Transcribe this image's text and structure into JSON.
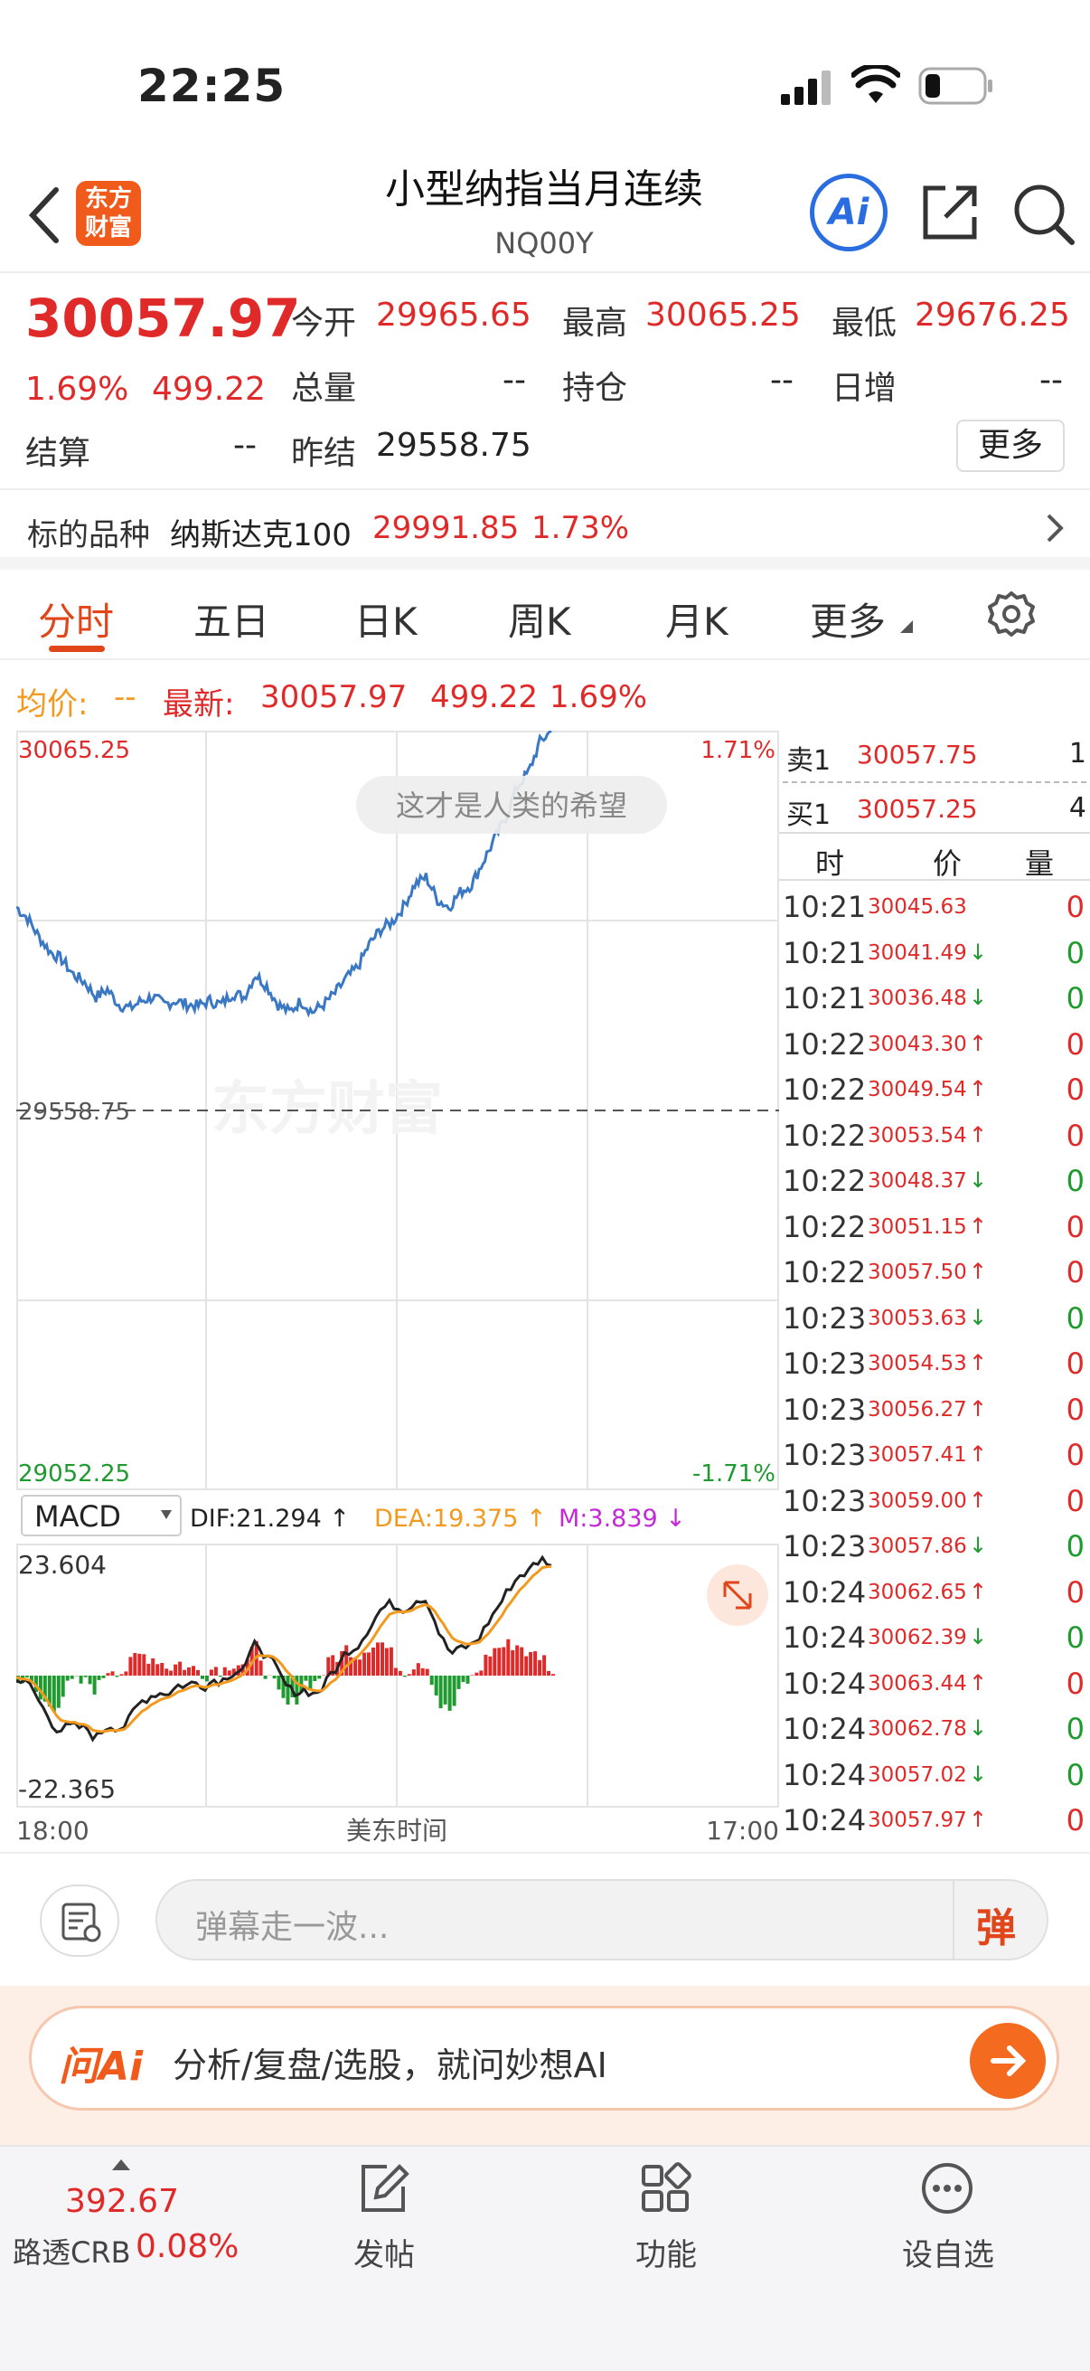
{
  "status_bar": {
    "time": "22:25"
  },
  "header": {
    "logo_text_line1": "东方",
    "logo_text_line2": "财富",
    "title": "小型纳指当月连续",
    "code": "NQ00Y",
    "ai_label": "Ai"
  },
  "quote": {
    "last_price": "30057.97",
    "change_pct": "1.69%",
    "change_amt": "499.22",
    "open_label": "今开",
    "open": "29965.65",
    "high_label": "最高",
    "high": "30065.25",
    "low_label": "最低",
    "low": "29676.25",
    "volume_label": "总量",
    "volume": "--",
    "oi_label": "持仓",
    "oi": "--",
    "daily_inc_label": "日增",
    "daily_inc": "--",
    "settle_label": "结算",
    "settle": "--",
    "prev_settle_label": "昨结",
    "prev_settle": "29558.75",
    "more_button": "更多"
  },
  "underlying": {
    "label": "标的品种",
    "name": "纳斯达克100",
    "price": "29991.85",
    "pct": "1.73%"
  },
  "tabs": [
    "分时",
    "五日",
    "日K",
    "周K",
    "月K",
    "更多"
  ],
  "price_bar": {
    "avg_label": "均价:",
    "avg_value": "--",
    "latest_label": "最新:",
    "latest_value": "30057.97",
    "change_amt": "499.22",
    "change_pct": "1.69%"
  },
  "chart": {
    "y_top": "30065.25",
    "y_mid": "29558.75",
    "y_bottom": "29052.25",
    "pct_top": "1.71%",
    "pct_bottom": "-1.71%",
    "bubble": "这才是人类的希望",
    "watermark": "东方财富",
    "macd_select": "MACD",
    "dif": "DIF:21.294 ↑",
    "dea": "DEA:19.375 ↑",
    "m": "M:3.839 ↓",
    "macd_top": "23.604",
    "macd_bottom": "-22.365",
    "x_start": "18:00",
    "x_mid": "美东时间",
    "x_end": "17:00",
    "colors": {
      "price_line": "#3a78c4",
      "dif": "#222222",
      "dea": "#f39a1e",
      "up": "#e02a2a",
      "down": "#1e9a2f"
    }
  },
  "chart_data": {
    "type": "line",
    "title": "",
    "xlabel": "美东时间",
    "ylabel": "",
    "ylim": [
      29052.25,
      30065.25
    ],
    "x_ticks": [
      "18:00",
      "17:00"
    ],
    "series": [
      {
        "values": [
          29830,
          29815,
          29790,
          29770,
          29760,
          29740,
          29730,
          29710,
          29720,
          29700,
          29695,
          29705,
          29710,
          29700,
          29705,
          29700,
          29698,
          29705,
          29700,
          29715,
          29710,
          29740,
          29725,
          29700,
          29690,
          29705,
          29690,
          29700,
          29715,
          29735,
          29750,
          29780,
          29800,
          29810,
          29830,
          29860,
          29870,
          29840,
          29830,
          29850,
          29860,
          29890,
          29920,
          29950,
          29990,
          30010,
          30050,
          30065
        ]
      }
    ]
  },
  "orderbook": {
    "sell_label": "卖1",
    "sell_price": "30057.75",
    "sell_qty": "1",
    "buy_label": "买1",
    "buy_price": "30057.25",
    "buy_qty": "4",
    "head_time": "时",
    "head_price": "价",
    "head_qty": "量",
    "ticks": [
      {
        "time": "10:21",
        "price": "30045.63",
        "arrow": "",
        "qty": "0",
        "dir": "up"
      },
      {
        "time": "10:21",
        "price": "30041.49",
        "arrow": "↓",
        "qty": "0",
        "dir": "down"
      },
      {
        "time": "10:21",
        "price": "30036.48",
        "arrow": "↓",
        "qty": "0",
        "dir": "down"
      },
      {
        "time": "10:22",
        "price": "30043.30",
        "arrow": "↑",
        "qty": "0",
        "dir": "up"
      },
      {
        "time": "10:22",
        "price": "30049.54",
        "arrow": "↑",
        "qty": "0",
        "dir": "up"
      },
      {
        "time": "10:22",
        "price": "30053.54",
        "arrow": "↑",
        "qty": "0",
        "dir": "up"
      },
      {
        "time": "10:22",
        "price": "30048.37",
        "arrow": "↓",
        "qty": "0",
        "dir": "down"
      },
      {
        "time": "10:22",
        "price": "30051.15",
        "arrow": "↑",
        "qty": "0",
        "dir": "up"
      },
      {
        "time": "10:22",
        "price": "30057.50",
        "arrow": "↑",
        "qty": "0",
        "dir": "up"
      },
      {
        "time": "10:23",
        "price": "30053.63",
        "arrow": "↓",
        "qty": "0",
        "dir": "down"
      },
      {
        "time": "10:23",
        "price": "30054.53",
        "arrow": "↑",
        "qty": "0",
        "dir": "up"
      },
      {
        "time": "10:23",
        "price": "30056.27",
        "arrow": "↑",
        "qty": "0",
        "dir": "up"
      },
      {
        "time": "10:23",
        "price": "30057.41",
        "arrow": "↑",
        "qty": "0",
        "dir": "up"
      },
      {
        "time": "10:23",
        "price": "30059.00",
        "arrow": "↑",
        "qty": "0",
        "dir": "up"
      },
      {
        "time": "10:23",
        "price": "30057.86",
        "arrow": "↓",
        "qty": "0",
        "dir": "down"
      },
      {
        "time": "10:24",
        "price": "30062.65",
        "arrow": "↑",
        "qty": "0",
        "dir": "up"
      },
      {
        "time": "10:24",
        "price": "30062.39",
        "arrow": "↓",
        "qty": "0",
        "dir": "down"
      },
      {
        "time": "10:24",
        "price": "30063.44",
        "arrow": "↑",
        "qty": "0",
        "dir": "up"
      },
      {
        "time": "10:24",
        "price": "30062.78",
        "arrow": "↓",
        "qty": "0",
        "dir": "down"
      },
      {
        "time": "10:24",
        "price": "30057.02",
        "arrow": "↓",
        "qty": "0",
        "dir": "down"
      },
      {
        "time": "10:24",
        "price": "30057.97",
        "arrow": "↑",
        "qty": "0",
        "dir": "up"
      }
    ]
  },
  "danmu": {
    "placeholder": "弹幕走一波...",
    "button": "弹"
  },
  "ai_bar": {
    "brand": "问Ai",
    "text": "分析/复盘/选股，就问妙想AI"
  },
  "tabbar": {
    "index_value": "392.67",
    "index_name": "路透CRB",
    "index_pct": "0.08%",
    "post_label": "发帖",
    "func_label": "功能",
    "watch_label": "设自选"
  }
}
